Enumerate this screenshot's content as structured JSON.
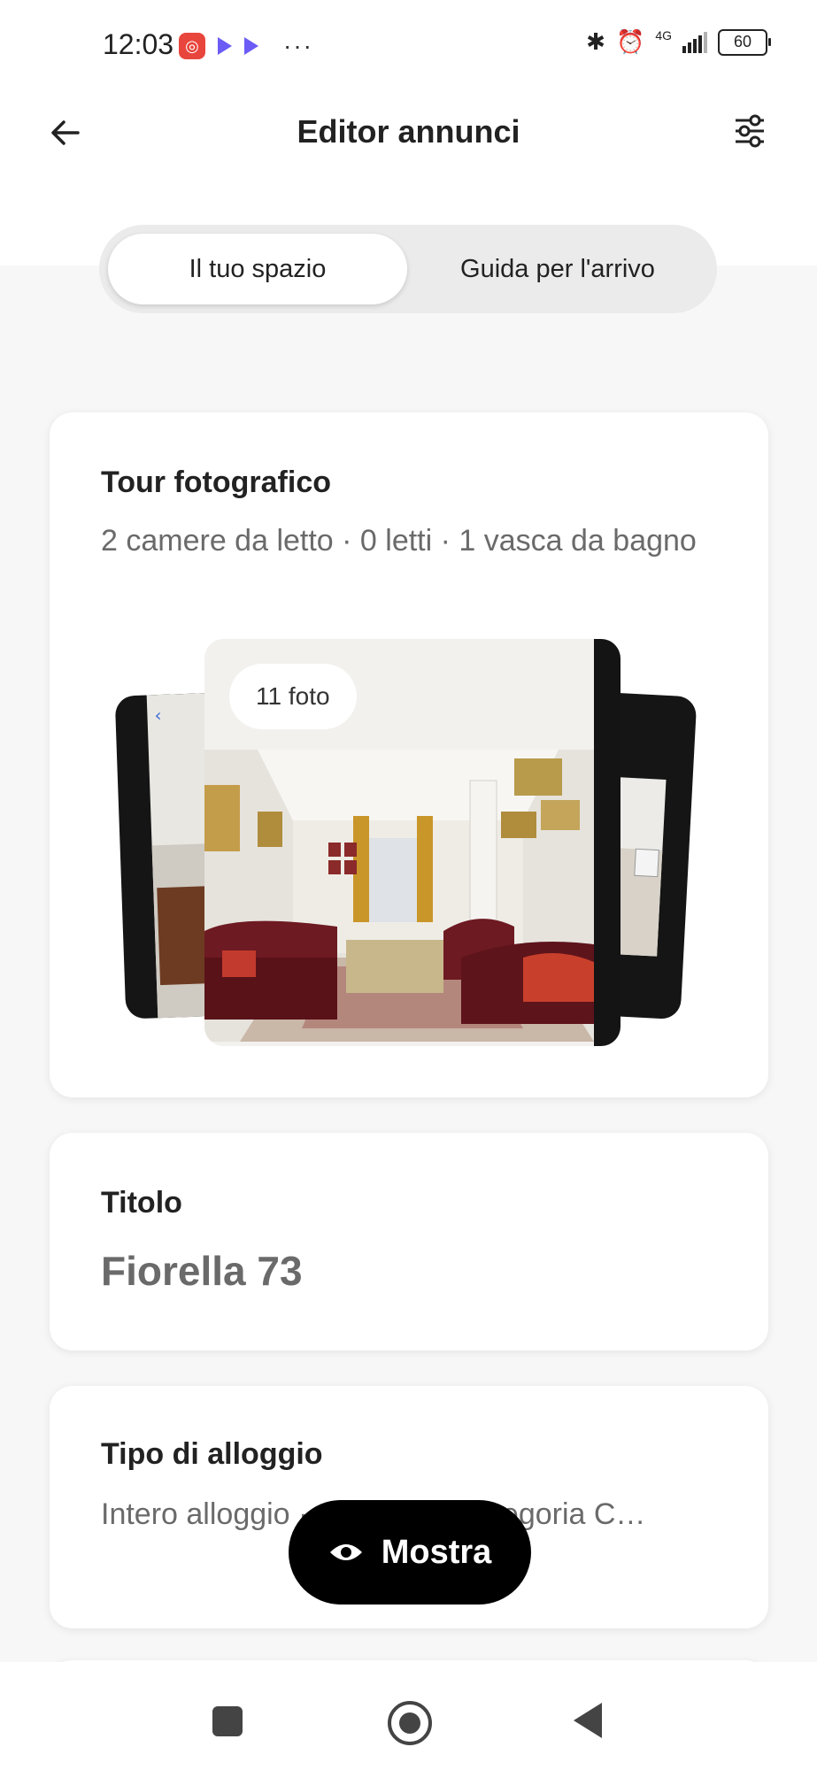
{
  "status_bar": {
    "time": "12:03",
    "network": "4G",
    "battery": "60",
    "more_indicator": "···"
  },
  "header": {
    "title": "Editor annunci",
    "back_icon": "arrow-left-icon",
    "filters_icon": "sliders-icon"
  },
  "tabs": [
    {
      "label": "Il tuo spazio",
      "active": true
    },
    {
      "label": "Guida per l'arrivo",
      "active": false
    }
  ],
  "photo_tour": {
    "title": "Tour fotografico",
    "subtitle": "2 camere da letto · 0 letti · 1 vasca da bagno",
    "photo_count_label": "11 foto"
  },
  "title_card": {
    "label": "Titolo",
    "value": "Fiorella 73"
  },
  "accommodation_card": {
    "label": "Tipo di alloggio",
    "value": "Intero alloggio · … affitto · Categoria C…"
  },
  "floating_button": {
    "label": "Mostra",
    "icon": "eye-icon"
  },
  "colors": {
    "accent": "#000000",
    "card_background": "#ffffff",
    "page_background": "#f7f7f7",
    "muted_text": "#6a6a6a"
  }
}
